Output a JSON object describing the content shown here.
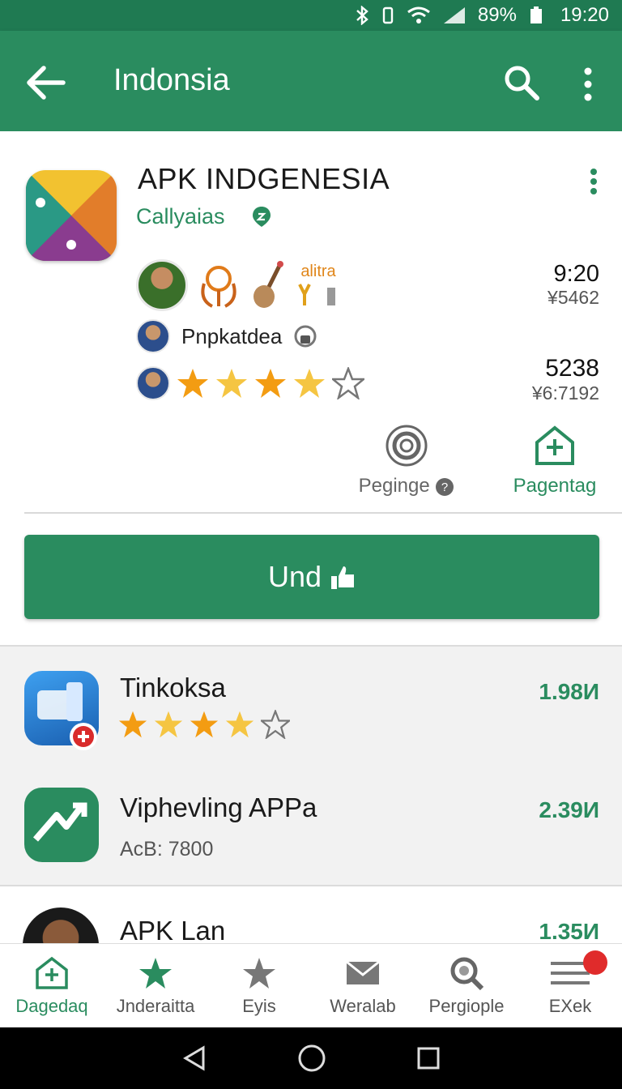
{
  "status_bar": {
    "battery": "89%",
    "time": "19:20"
  },
  "app_bar": {
    "title": "Indonsia"
  },
  "featured": {
    "title": "APK INDGENESIA",
    "developer": "Callyaias",
    "badge_text": "alitra",
    "time": "9:20",
    "sub_value": "¥5462",
    "name": "Pnpkatdea",
    "count": "5238",
    "sub_count": "¥6:7192",
    "rating": 4,
    "action_left": "Peginge",
    "action_right": "Pagentag",
    "install_label": "Und"
  },
  "list": [
    {
      "name": "Tinkoksa",
      "size": "1.98И",
      "rating": 4
    },
    {
      "name": "Viphevling APPa",
      "size": "2.39И",
      "sub": "AcB: 7800"
    },
    {
      "name": "APK Lan",
      "size": "1.35И"
    }
  ],
  "bottom_nav": [
    {
      "label": "Dagedaq",
      "icon": "home-plus-icon",
      "active": true
    },
    {
      "label": "Jnderaitta",
      "icon": "star-icon",
      "active": true
    },
    {
      "label": "Eyis",
      "icon": "star-icon",
      "active": false
    },
    {
      "label": "Weralab",
      "icon": "mail-icon",
      "active": false
    },
    {
      "label": "Pergiople",
      "icon": "search-icon",
      "active": false
    },
    {
      "label": "EXek",
      "icon": "menu-icon",
      "active": false
    }
  ],
  "colors": {
    "primary": "#2a8c5f",
    "primary_dark": "#1f7a52",
    "star": "#f39c12",
    "badge": "#e02b2b"
  }
}
